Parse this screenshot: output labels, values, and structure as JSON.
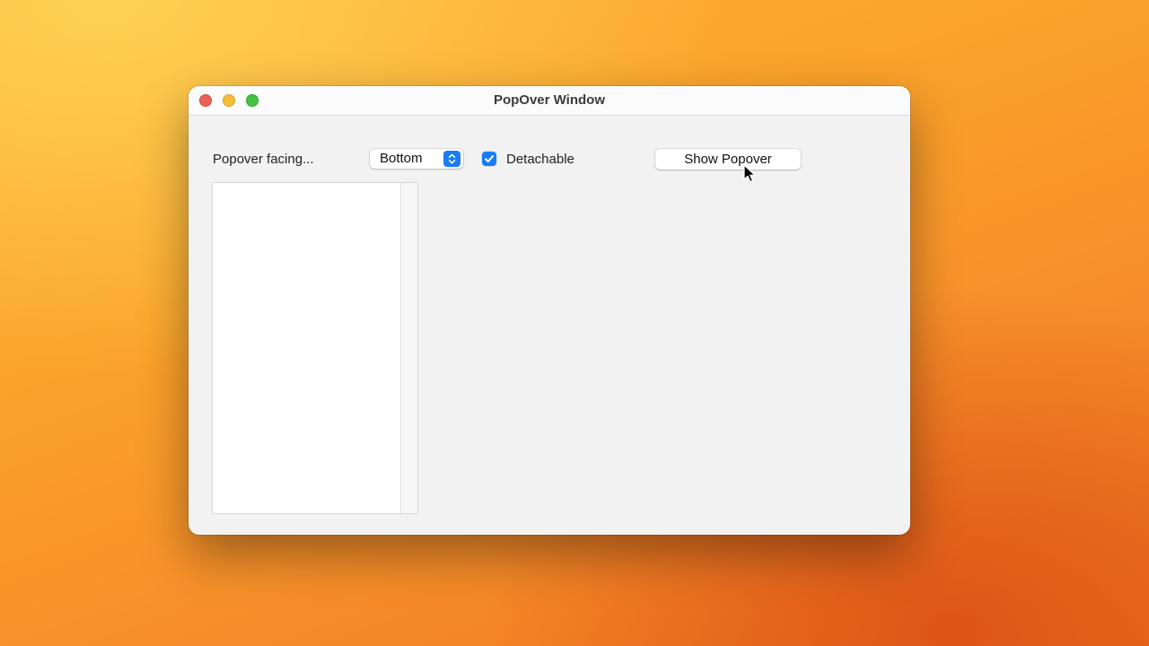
{
  "window": {
    "title": "PopOver Window"
  },
  "controls": {
    "facing_label": "Popover facing...",
    "facing_selected": "Bottom",
    "detachable_label": "Detachable",
    "detachable_checked": true,
    "show_button_label": "Show Popover"
  },
  "colors": {
    "accent": "#1a7cf5",
    "close": "#ec5f57",
    "minimize": "#f4bd3b",
    "zoom": "#43c345",
    "window_background": "#f2f2f2"
  },
  "icons": {
    "popup_stepper": "chevron-up-down-icon",
    "checkbox": "checkmark-icon",
    "cursor": "arrow-cursor-icon"
  }
}
